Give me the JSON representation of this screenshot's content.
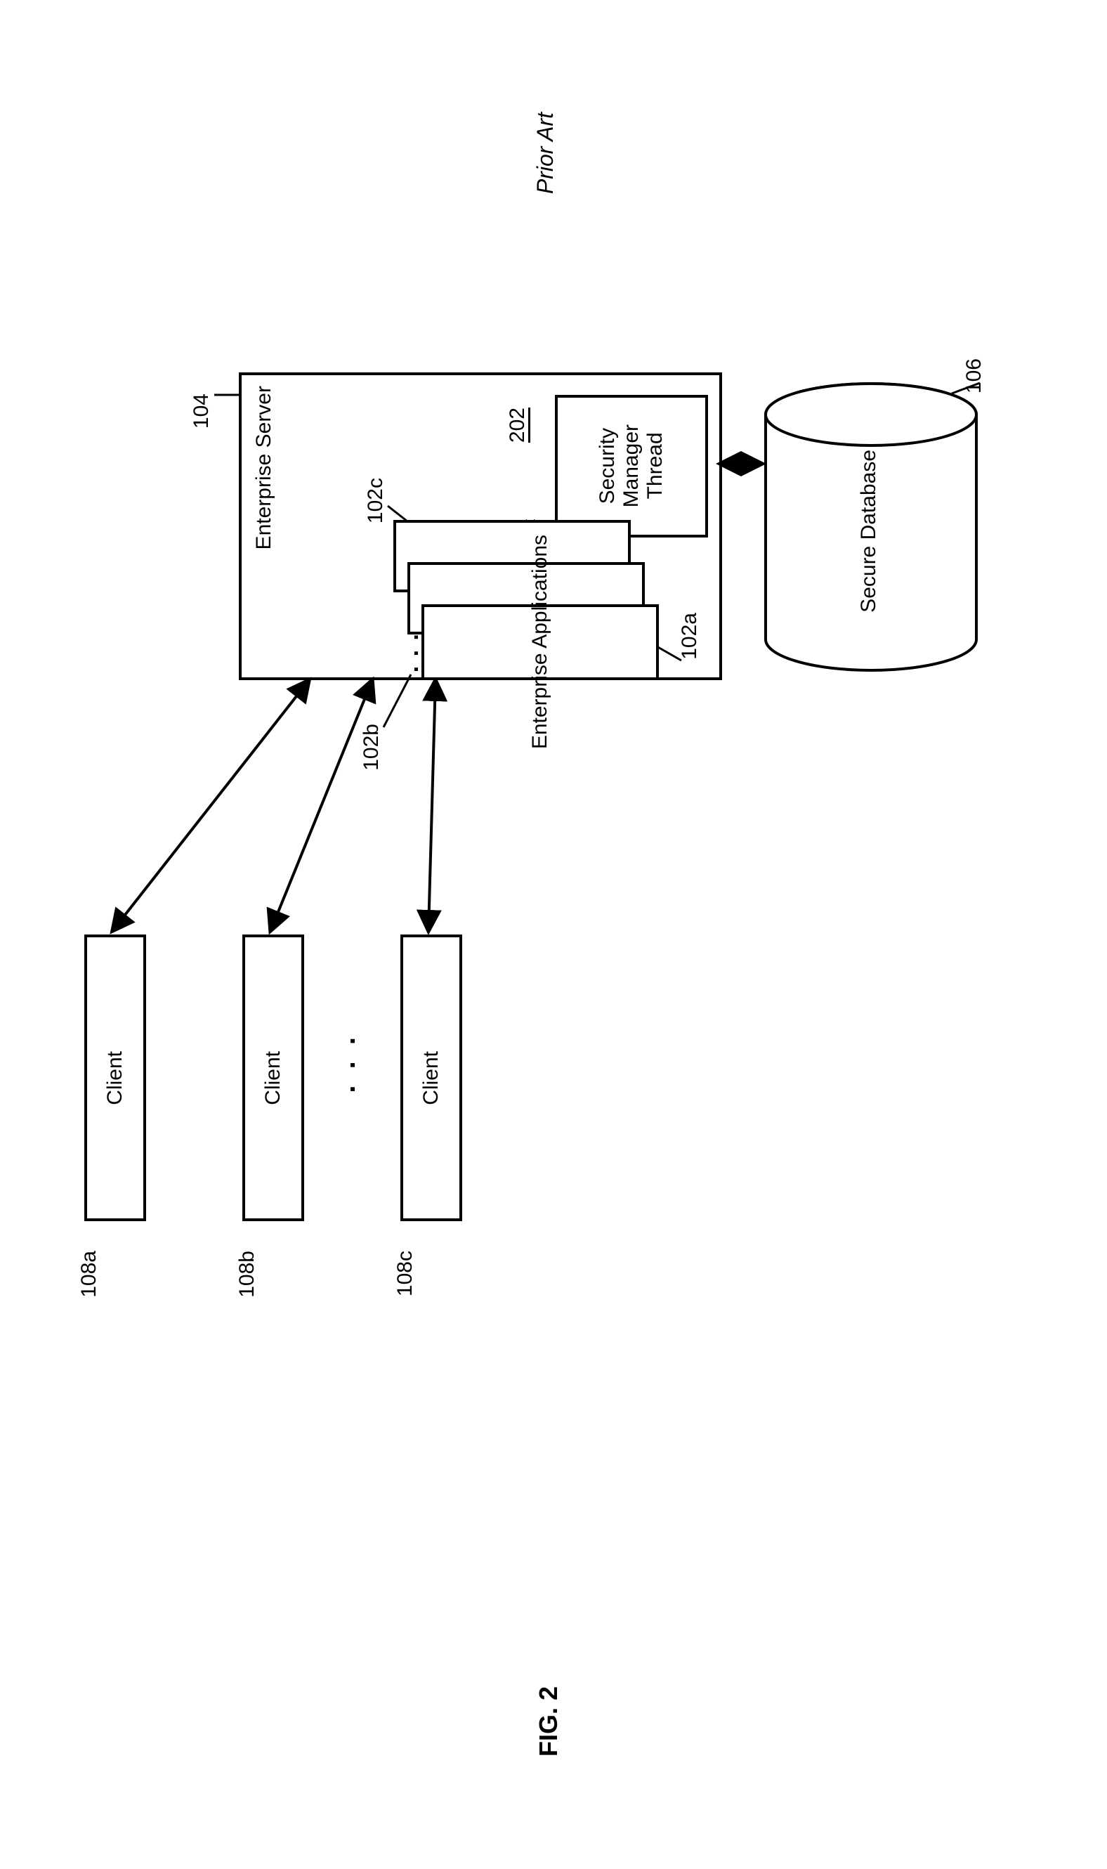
{
  "header": {
    "title": "Prior Art"
  },
  "figure": {
    "caption": "FIG. 2"
  },
  "clients": {
    "label_a": "108a",
    "label_b": "108b",
    "label_c": "108c",
    "text": "Client",
    "ellipsis": ". . ."
  },
  "server": {
    "title": "Enterprise Server",
    "label": "104"
  },
  "apps": {
    "text": "Enterprise Applications",
    "label_a": "102a",
    "label_b": "102b",
    "label_c": "102c",
    "dots": ". . ."
  },
  "security": {
    "text": "Security\nManager\nThread",
    "label": "202"
  },
  "database": {
    "text": "Secure Database",
    "label": "106"
  }
}
